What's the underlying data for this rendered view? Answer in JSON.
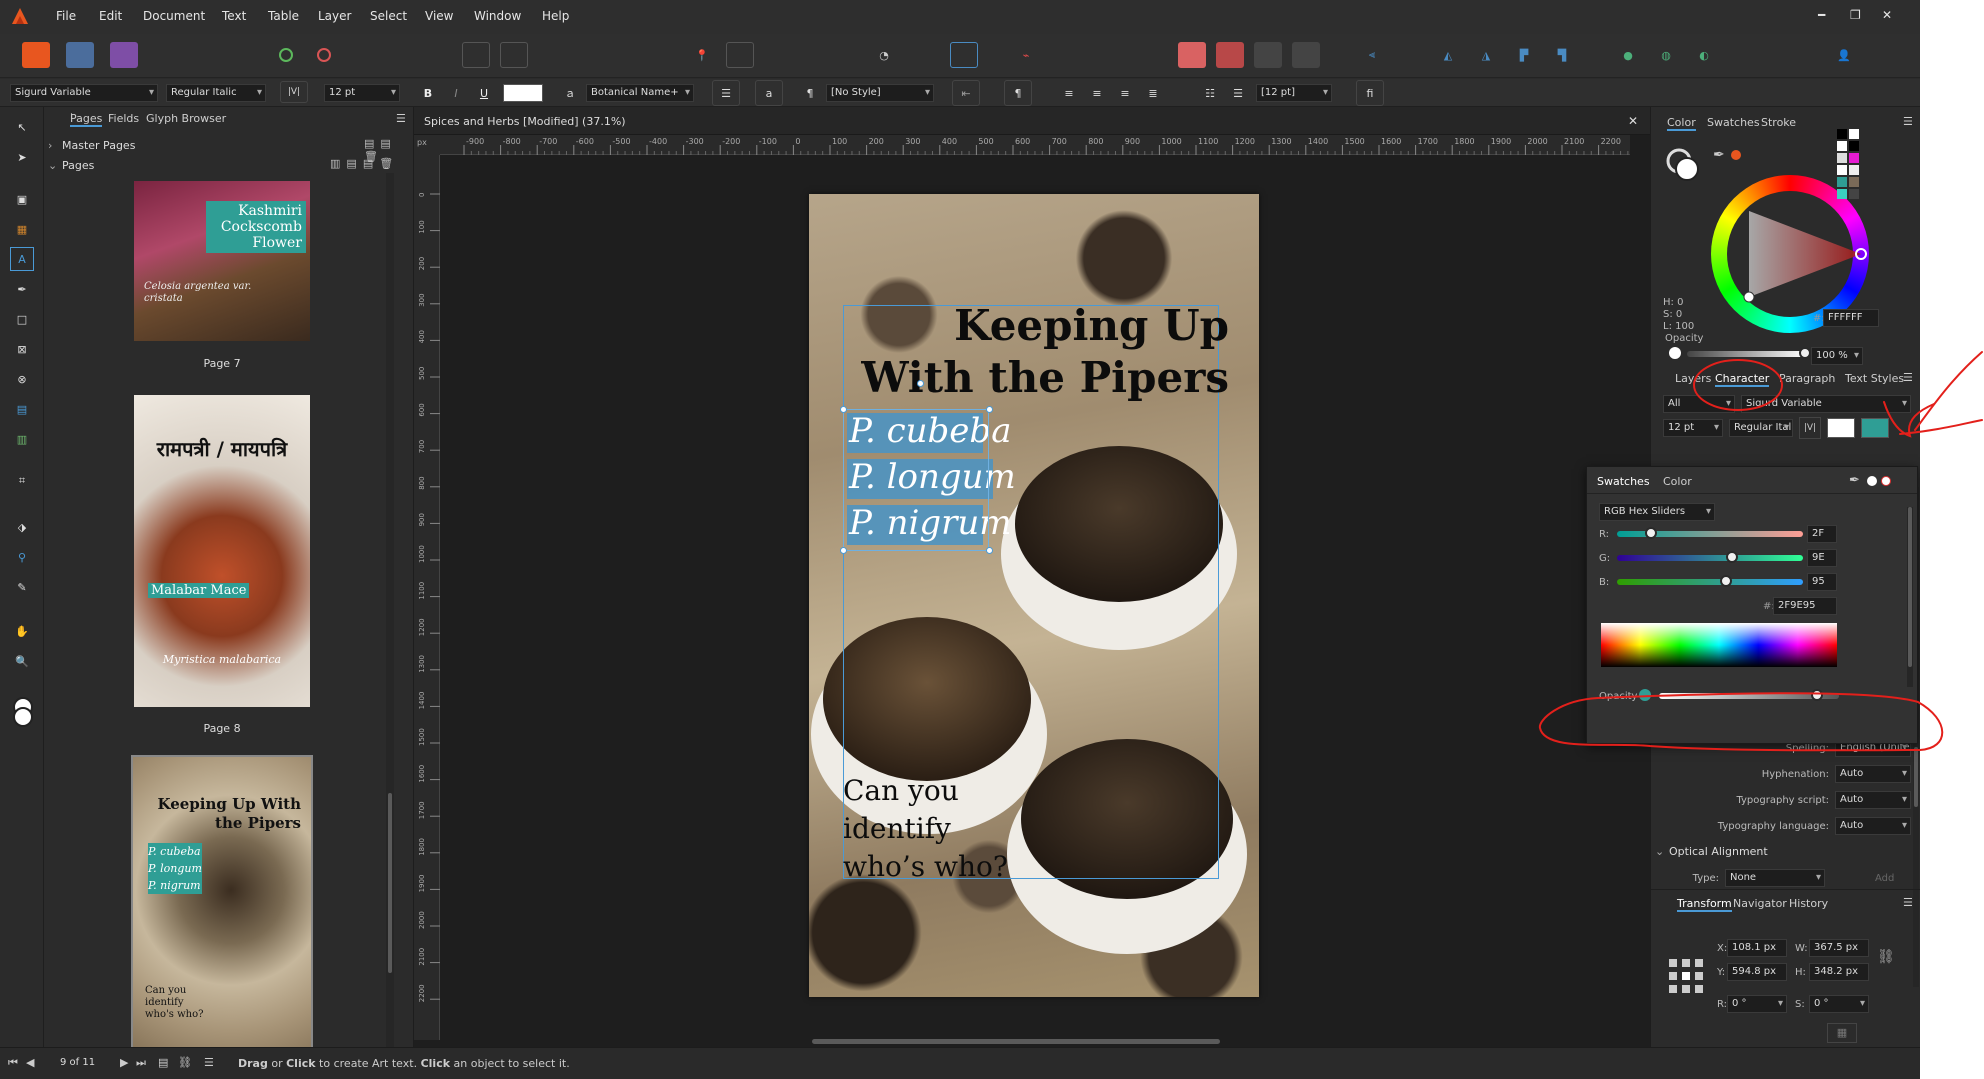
{
  "menubar": {
    "items": [
      "File",
      "Edit",
      "Document",
      "Text",
      "Table",
      "Layer",
      "Select",
      "View",
      "Window",
      "Help"
    ]
  },
  "context_toolbar": {
    "font": "Sigurd Variable",
    "style": "Regular Italic",
    "size": "12 pt",
    "bold": "B",
    "italic": "I",
    "underline": "U",
    "font2": "Botanical Name+",
    "char_style": "[No Style]",
    "leading": "[12 pt]",
    "ligature": "fi",
    "a_label": "a",
    "pilcrow": "¶"
  },
  "pages_panel": {
    "tabs": [
      "Pages",
      "Fields",
      "Glyph Browser"
    ],
    "master_pages": "Master Pages",
    "pages": "Pages",
    "thumbs": [
      {
        "label": "Page 7",
        "title": "Kashmiri Cockscomb Flower",
        "subtitle": "Celosia argentea var. cristata"
      },
      {
        "label": "Page 8",
        "title": "रामपत्री / मायपत्रि",
        "name": "Malabar Mace",
        "subtitle": "Myristica malabarica"
      },
      {
        "label": "",
        "title": "Keeping Up With the Pipers",
        "names": [
          "P. cubeba",
          "P. longum",
          "P. nigrum"
        ],
        "footer": "Can you identify who's who?"
      }
    ]
  },
  "document": {
    "tab_title": "Spices and Herbs [Modified] (37.1%)",
    "unit": "px",
    "ruler_labels": [
      "-900",
      "-800",
      "-700",
      "-600",
      "-500",
      "-400",
      "-300",
      "-200",
      "-100",
      "0",
      "100",
      "200",
      "300",
      "400",
      "500",
      "600",
      "700",
      "800",
      "900",
      "1000",
      "1100",
      "1200",
      "1300",
      "1400",
      "1500",
      "1600",
      "1700",
      "1800",
      "1900",
      "2000",
      "2100",
      "2200"
    ],
    "ruler_v_labels": [
      "0",
      "100",
      "200",
      "300",
      "400",
      "500",
      "600",
      "700",
      "800",
      "900",
      "1000",
      "1100",
      "1200",
      "1300",
      "1400",
      "1500",
      "1600",
      "1700",
      "1800",
      "1900",
      "2000",
      "2100",
      "2200"
    ],
    "headline_1": "Keeping Up",
    "headline_2": "With the Pipers",
    "species": [
      "P. cubeba",
      "P. longum",
      "P. nigrum"
    ],
    "question": [
      "Can you",
      "identify",
      "who’s who?"
    ]
  },
  "color_panel": {
    "tabs": [
      "Color",
      "Swatches",
      "Stroke"
    ],
    "h": "H: 0",
    "s": "S: 0",
    "l": "L: 100",
    "hex": "FFFFFF",
    "opacity_label": "Opacity",
    "opacity_value": "100 %",
    "opacity_fraction": 1.0
  },
  "character_panel": {
    "tabs": [
      "Layers",
      "Character",
      "Paragraph",
      "Text Styles"
    ],
    "scope": "All",
    "font": "Sigurd Variable",
    "size": "12 pt",
    "style": "Regular Ital",
    "fill_color": "#2F9E95",
    "spelling_label": "Spelling:",
    "spelling_value": "English (United States)",
    "hyphenation_label": "Hyphenation:",
    "hyphenation_value": "Auto",
    "typo_script_label": "Typography script:",
    "typo_script_value": "Auto",
    "typo_lang_label": "Typography language:",
    "typo_lang_value": "Auto",
    "optical_alignment": "Optical Alignment",
    "type_label": "Type:",
    "type_value": "None",
    "add_label": "Add"
  },
  "color_popover": {
    "tabs": [
      "Swatches",
      "Color"
    ],
    "mode": "RGB Hex Sliders",
    "r_label": "R:",
    "g_label": "G:",
    "b_label": "B:",
    "r": "2F",
    "g": "9E",
    "b": "95",
    "r_fraction": 0.184,
    "g_fraction": 0.62,
    "b_fraction": 0.584,
    "hex_label": "#:",
    "hex": "2F9E95",
    "opacity_label": "Opacity",
    "opacity_fraction": 0.88,
    "accent": "#2F9E95"
  },
  "transform_panel": {
    "tabs": [
      "Transform",
      "Navigator",
      "History"
    ],
    "x_label": "X:",
    "x": "108.1 px",
    "y_label": "Y:",
    "y": "594.8 px",
    "w_label": "W:",
    "w": "367.5 px",
    "h_label": "H:",
    "h": "348.2 px",
    "r_label": "R:",
    "r": "0 °",
    "s_label": "S:",
    "s": "0 °"
  },
  "statusbar": {
    "page_indicator": "9 of 11",
    "hint_bold1": "Drag",
    "hint_or": " or ",
    "hint_bold2": "Click",
    "hint_mid": " to create Art text. ",
    "hint_bold3": "Click",
    "hint_end": " an object to select it."
  },
  "colors": {
    "annotation_red": "#e3201b",
    "accent_teal": "#2F9E95",
    "selection_blue": "#4e93c1",
    "app_logo_orange": "#e8561f"
  }
}
